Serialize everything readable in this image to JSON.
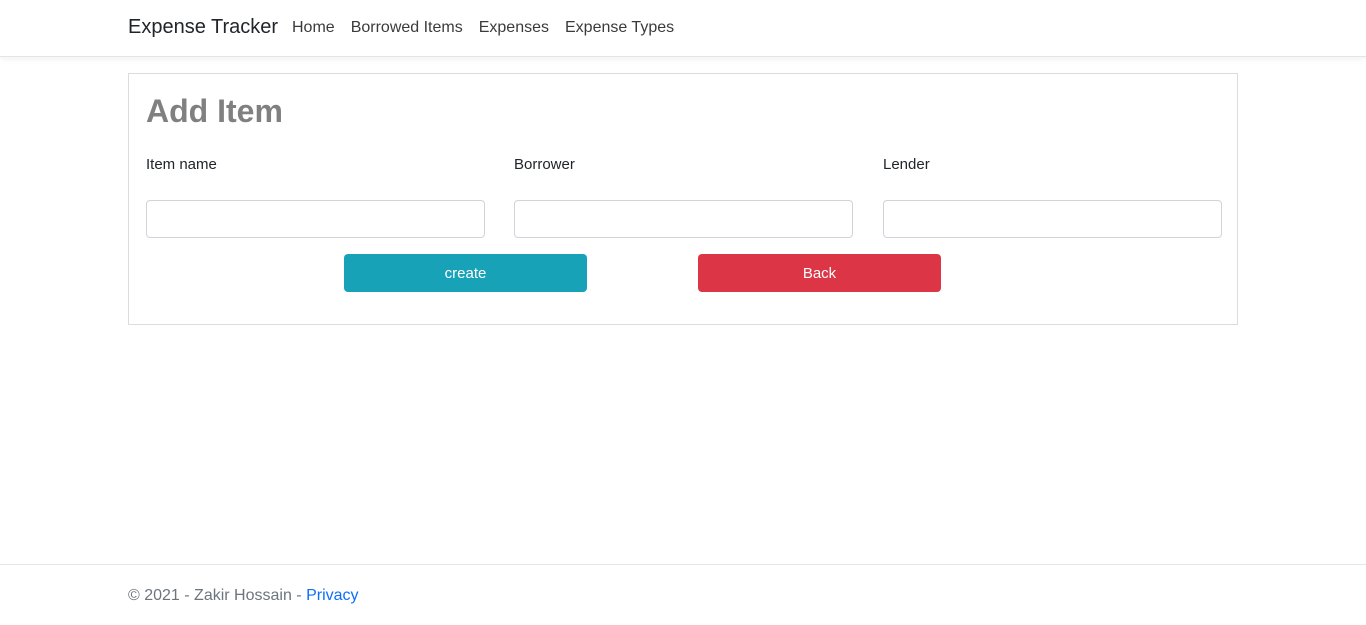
{
  "navbar": {
    "brand": "Expense Tracker",
    "links": [
      "Home",
      "Borrowed Items",
      "Expenses",
      "Expense Types"
    ]
  },
  "form": {
    "title": "Add Item",
    "fields": [
      {
        "label": "Item name",
        "value": ""
      },
      {
        "label": "Borrower",
        "value": ""
      },
      {
        "label": "Lender",
        "value": ""
      }
    ],
    "create_label": "create",
    "back_label": "Back"
  },
  "footer": {
    "text": "© 2021 - Zakir Hossain - ",
    "privacy_link": "Privacy"
  },
  "colors": {
    "create_button": "#17a2b8",
    "back_button": "#dc3545",
    "link": "#0d6efd"
  }
}
